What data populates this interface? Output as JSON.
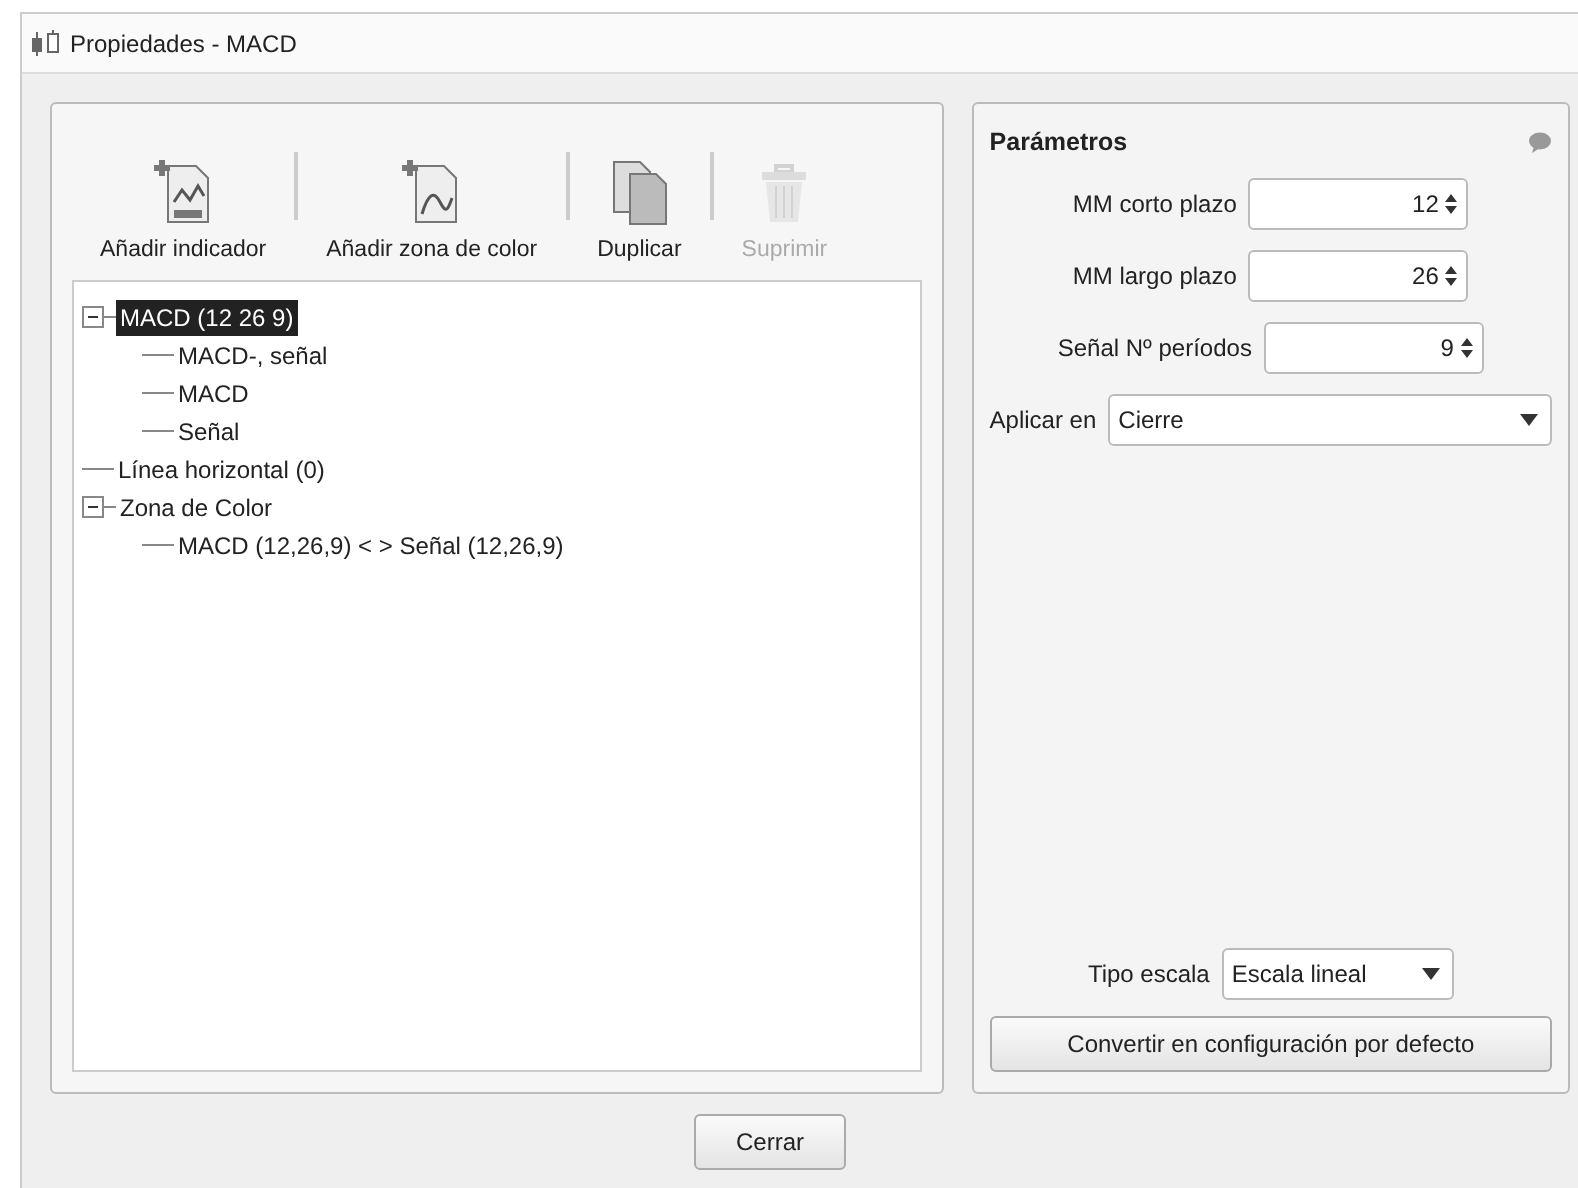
{
  "window": {
    "title": "Propiedades - MACD"
  },
  "toolbar": [
    {
      "kind": "indicator",
      "label": "Añadir indicador",
      "disabled": false
    },
    {
      "kind": "zone",
      "label": "Añadir zona de color",
      "disabled": false
    },
    {
      "kind": "duplicate",
      "label": "Duplicar",
      "disabled": false
    },
    {
      "kind": "delete",
      "label": "Suprimir",
      "disabled": true
    }
  ],
  "tree": [
    {
      "label": "MACD (12 26 9)",
      "selected": true,
      "expanded": true,
      "children": [
        {
          "label": "MACD-, señal",
          "selected": false
        },
        {
          "label": "MACD",
          "selected": false
        },
        {
          "label": "Señal",
          "selected": false
        }
      ]
    },
    {
      "label": "Línea horizontal (0)",
      "selected": false
    },
    {
      "label": "Zona de Color",
      "selected": false,
      "expanded": true,
      "children": [
        {
          "label": "MACD (12,26,9) < > Señal (12,26,9)",
          "selected": false
        }
      ]
    }
  ],
  "parameters": {
    "title": "Parámetros",
    "fields": [
      {
        "kind": "spin",
        "label": "MM corto plazo",
        "value": "12"
      },
      {
        "kind": "spin",
        "label": "MM largo plazo",
        "value": "26"
      },
      {
        "kind": "spin",
        "label": "Señal Nº períodos",
        "value": "9"
      },
      {
        "kind": "select",
        "label": "Aplicar en",
        "value": "Cierre"
      }
    ],
    "scale": {
      "label": "Tipo escala",
      "value": "Escala lineal"
    },
    "default_button": "Convertir en configuración por defecto"
  },
  "close_button": "Cerrar"
}
